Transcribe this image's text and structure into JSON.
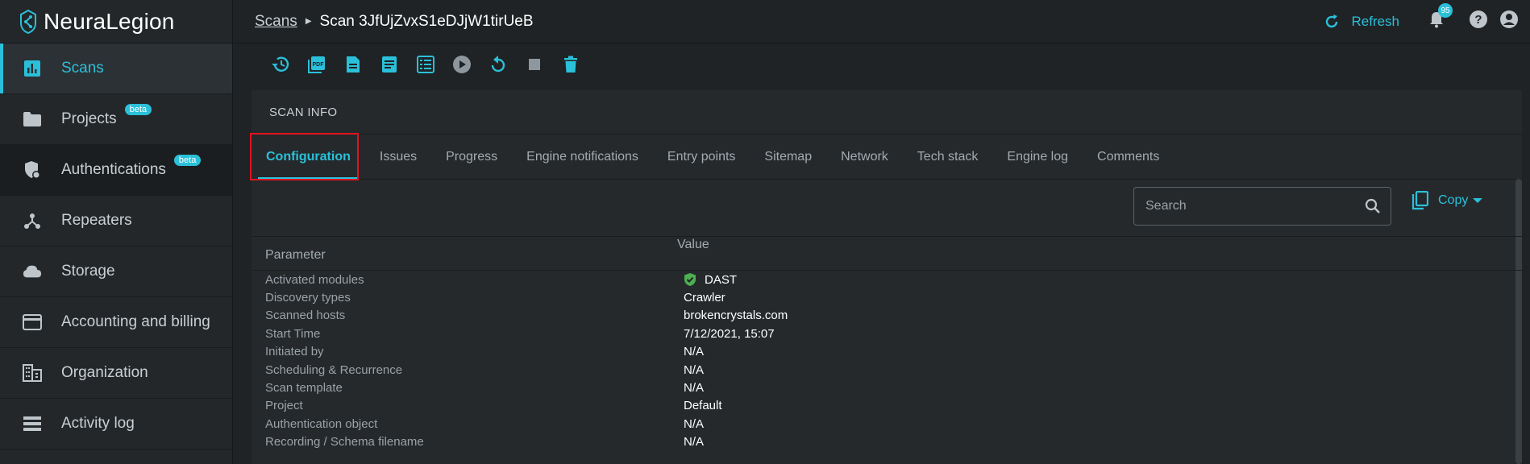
{
  "app": {
    "name": "NeuraLegion"
  },
  "sidebar": {
    "items": [
      {
        "label": "Scans",
        "icon": "bar-chart-icon",
        "active": true
      },
      {
        "label": "Projects",
        "icon": "folder-icon",
        "badge": "beta"
      },
      {
        "label": "Authentications",
        "icon": "shield-lock-icon",
        "badge": "beta"
      },
      {
        "label": "Repeaters",
        "icon": "repeater-icon"
      },
      {
        "label": "Storage",
        "icon": "cloud-icon"
      },
      {
        "label": "Accounting and billing",
        "icon": "credit-card-icon"
      },
      {
        "label": "Organization",
        "icon": "building-icon"
      },
      {
        "label": "Activity log",
        "icon": "list-icon"
      }
    ]
  },
  "header": {
    "breadcrumb_root": "Scans",
    "breadcrumb_current": "Scan 3JfUjZvxS1eDJjW1tirUeB",
    "refresh_label": "Refresh",
    "notification_count": "95"
  },
  "toolbar": {
    "icons": [
      "history-icon",
      "pdf-icon",
      "document-icon",
      "report-icon",
      "table-icon",
      "play-icon",
      "retry-icon",
      "stop-icon",
      "delete-icon"
    ]
  },
  "panel": {
    "title": "SCAN INFO",
    "tabs": [
      "Configuration",
      "Issues",
      "Progress",
      "Engine notifications",
      "Entry points",
      "Sitemap",
      "Network",
      "Tech stack",
      "Engine log",
      "Comments"
    ],
    "active_tab": "Configuration",
    "search_placeholder": "Search",
    "copy_label": "Copy",
    "columns": {
      "parameter": "Parameter",
      "value": "Value"
    },
    "rows": [
      {
        "key": "Activated modules",
        "value": "DAST",
        "icon": "shield-check-icon"
      },
      {
        "key": "Discovery types",
        "value": "Crawler"
      },
      {
        "key": "Scanned hosts",
        "value": "brokencrystals.com"
      },
      {
        "key": "Start Time",
        "value": "7/12/2021, 15:07"
      },
      {
        "key": "Initiated by",
        "value": "N/A"
      },
      {
        "key": "Scheduling & Recurrence",
        "value": "N/A"
      },
      {
        "key": "Scan template",
        "value": "N/A"
      },
      {
        "key": "Project",
        "value": "Default"
      },
      {
        "key": "Authentication object",
        "value": "N/A"
      },
      {
        "key": "Recording / Schema filename",
        "value": "N/A"
      }
    ]
  },
  "colors": {
    "accent": "#2bc0d9",
    "success": "#4caf50",
    "highlight": "#e0141e"
  }
}
